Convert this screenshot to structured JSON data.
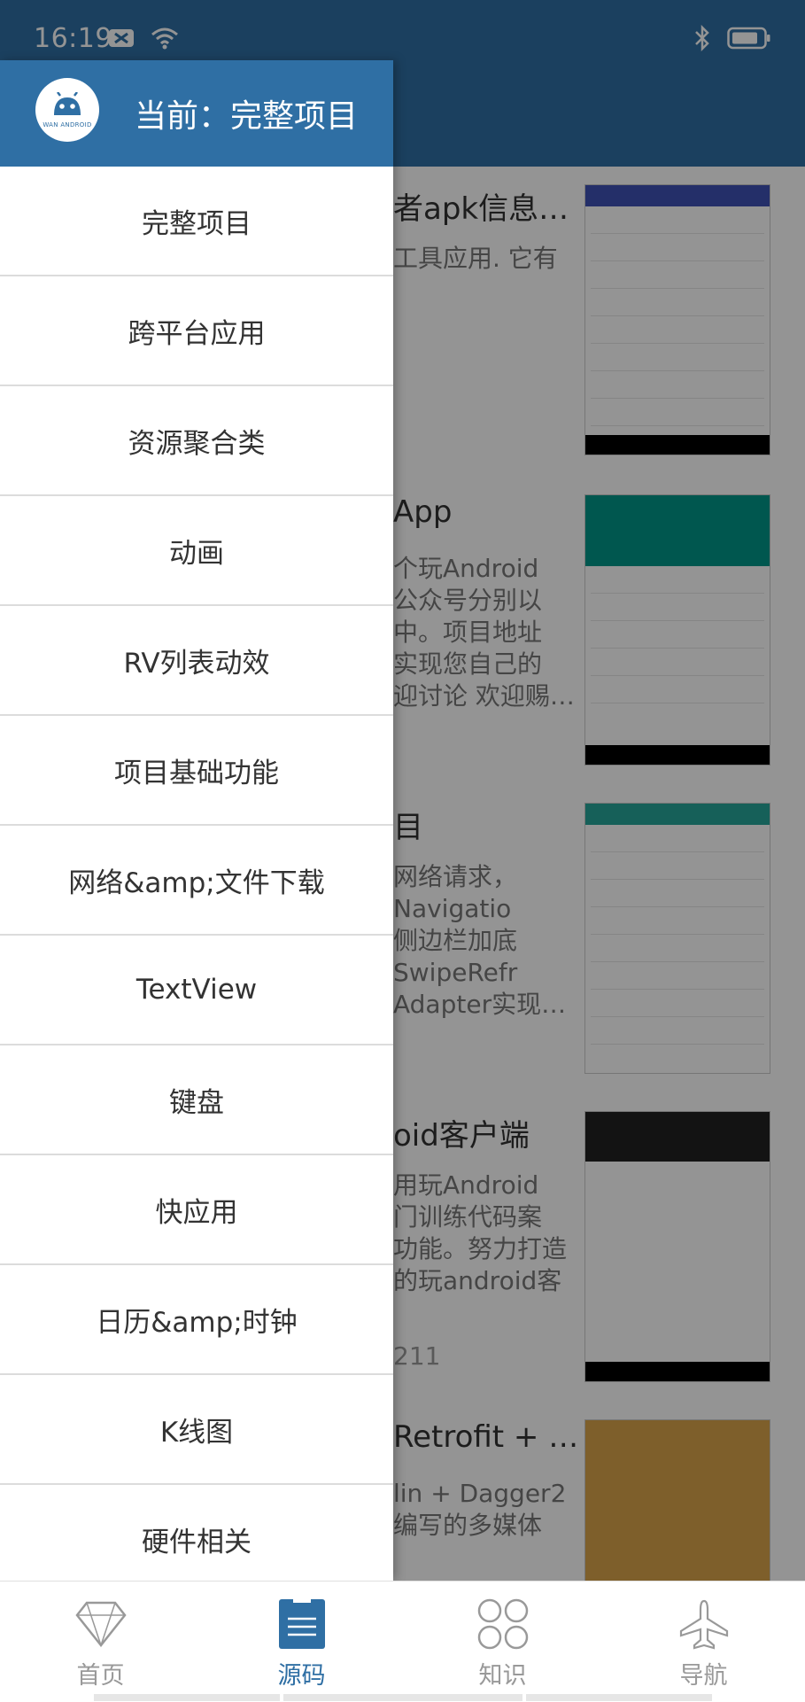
{
  "status_bar": {
    "time": "16:19"
  },
  "drawer": {
    "header_title": "当前：完整项目",
    "logo_text": "WAN ANDROID",
    "categories": [
      "完整项目",
      "跨平台应用",
      "资源聚合类",
      "动画",
      "RV列表动效",
      "项目基础功能",
      "网络&amp;文件下载",
      "TextView",
      "键盘",
      "快应用",
      "日历&amp;时钟",
      "K线图",
      "硬件相关"
    ]
  },
  "background_list": {
    "cards": [
      {
        "title": "者apk信息…",
        "desc": "工具应用. 它有"
      },
      {
        "title": "App",
        "desc": "个玩Android\n 公众号分别以\n中。项目地址\n实现您自己的\n迎讨论 欢迎赐…"
      },
      {
        "title": "目",
        "desc": "网络请求，\nNavigatio\n侧边栏加底\nSwipeRefr\nAdapter实现…"
      },
      {
        "title": "oid客户端",
        "desc": "用玩Android\n门训练代码案\n功能。努力打造\n的玩android客",
        "meta": "211"
      },
      {
        "title": " Retrofit + …",
        "desc": "lin + Dagger2\n编写的多媒体"
      }
    ]
  },
  "bottom_nav": {
    "tabs": [
      {
        "label": "首页",
        "icon": "diamond-icon"
      },
      {
        "label": "源码",
        "icon": "document-icon"
      },
      {
        "label": "知识",
        "icon": "grid-circles-icon"
      },
      {
        "label": "导航",
        "icon": "airplane-icon"
      }
    ],
    "active_index": 1
  },
  "colors": {
    "primary": "#2f6fa4",
    "inactive": "#999999"
  }
}
